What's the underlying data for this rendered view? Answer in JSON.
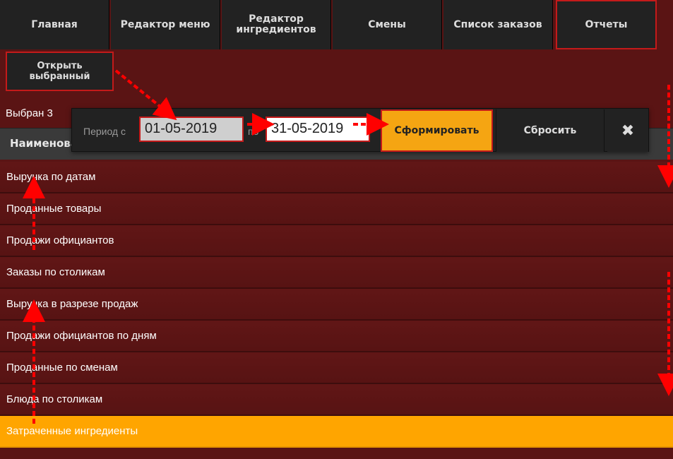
{
  "nav": {
    "tabs": [
      {
        "label": "Главная"
      },
      {
        "label": "Редактор меню"
      },
      {
        "label": "Редактор ингредиентов"
      },
      {
        "label": "Смены"
      },
      {
        "label": "Список заказов"
      },
      {
        "label": "Отчеты"
      }
    ]
  },
  "toolbar": {
    "open_selected_label": "Открыть выбранный",
    "selected_text": "Выбран 3"
  },
  "table": {
    "header": "Наименование"
  },
  "reports": [
    {
      "label": "Выручка по датам"
    },
    {
      "label": "Проданные товары"
    },
    {
      "label": "Продажи официантов"
    },
    {
      "label": "Заказы по столикам"
    },
    {
      "label": "Выручка в разрезе продаж"
    },
    {
      "label": "Продажи официантов по дням"
    },
    {
      "label": "Проданные по сменам"
    },
    {
      "label": "Блюда по столикам"
    },
    {
      "label": "Затраченные ингредиенты"
    }
  ],
  "period": {
    "label": "Период с",
    "to_label": "по",
    "date_from": "01-05-2019",
    "date_to": "31-05-2019",
    "form_button": "Сформировать",
    "reset_button": "Сбросить",
    "close_glyph": "✖"
  },
  "colors": {
    "background": "#5a1414",
    "accent": "#ffa500",
    "highlight_border": "#c41a1a",
    "annotation": "#ff0000"
  }
}
